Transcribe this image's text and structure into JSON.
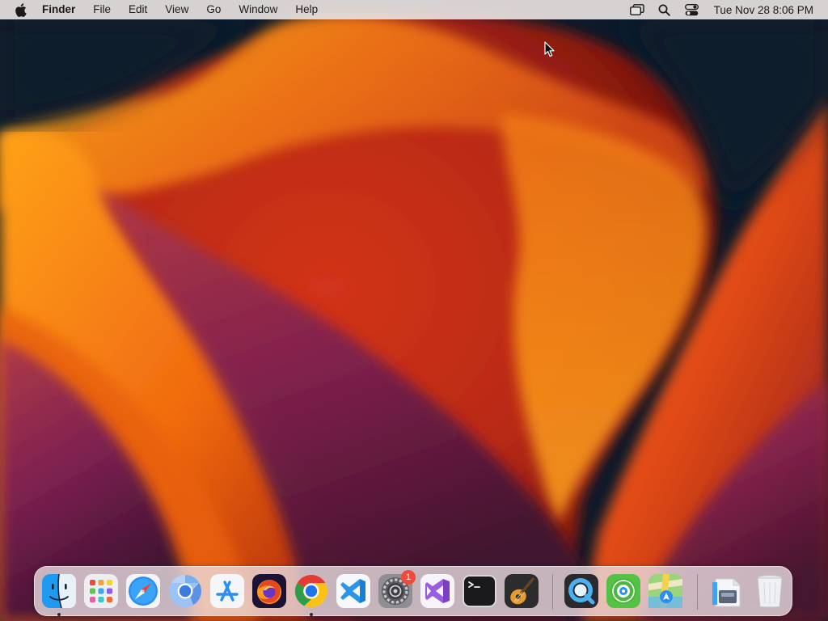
{
  "menubar": {
    "app_name": "Finder",
    "menus": [
      "File",
      "Edit",
      "View",
      "Go",
      "Window",
      "Help"
    ],
    "status_icons": [
      "window-switcher-icon",
      "search-icon",
      "control-center-icon"
    ],
    "clock": "Tue Nov 28  8:06 PM"
  },
  "dock": {
    "apps": [
      {
        "name": "Finder",
        "icon": "finder-icon",
        "running": true
      },
      {
        "name": "Launchpad",
        "icon": "launchpad-icon",
        "running": false
      },
      {
        "name": "Safari",
        "icon": "safari-icon",
        "running": false
      },
      {
        "name": "Chromium",
        "icon": "chromium-icon",
        "running": false
      },
      {
        "name": "App Store",
        "icon": "app-store-icon",
        "running": false
      },
      {
        "name": "Firefox",
        "icon": "firefox-icon",
        "running": false
      },
      {
        "name": "Google Chrome",
        "icon": "chrome-icon",
        "running": true
      },
      {
        "name": "Visual Studio Code",
        "icon": "vscode-icon",
        "running": false
      },
      {
        "name": "System Settings",
        "icon": "system-settings-icon",
        "running": false,
        "badge": "1"
      },
      {
        "name": "Visual Studio",
        "icon": "visual-studio-icon",
        "running": false
      },
      {
        "name": "Terminal",
        "icon": "terminal-icon",
        "running": false
      },
      {
        "name": "GarageBand",
        "icon": "garageband-icon",
        "running": false
      },
      {
        "name": "QuickTime Player",
        "icon": "quicktime-icon",
        "running": false
      },
      {
        "name": "Find My",
        "icon": "find-my-icon",
        "running": false
      },
      {
        "name": "Maps",
        "icon": "maps-icon",
        "running": false
      }
    ],
    "stack": {
      "name": "Downloads",
      "icon": "downloads-stack-icon"
    },
    "trash": {
      "name": "Trash",
      "icon": "trash-icon"
    }
  },
  "colors": {
    "wallpaper_dark": "#0c1a2a",
    "wallpaper_orange": "#f08a12",
    "wallpaper_red": "#c02a12",
    "wallpaper_magenta": "#7a1d4e",
    "badge": "#f04a3c"
  }
}
